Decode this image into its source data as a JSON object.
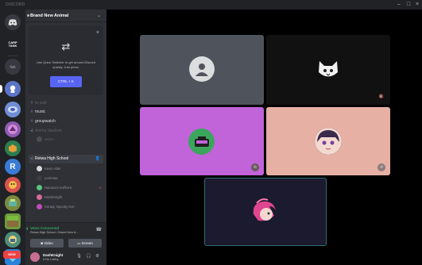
{
  "titlebar": {
    "title": "DISCORD",
    "minimize_icon": "minimize-icon",
    "maximize_icon": "maximize-icon",
    "close_icon": "close-icon"
  },
  "guilds": {
    "items": [
      {
        "name": "home",
        "label": ""
      },
      {
        "name": "carp-tank",
        "label": "CARP TANK"
      },
      {
        "name": "fish",
        "label": "fish"
      },
      {
        "name": "guild-3",
        "label": ""
      },
      {
        "name": "guild-4",
        "label": ""
      },
      {
        "name": "guild-5",
        "label": ""
      },
      {
        "name": "guild-6",
        "label": ""
      },
      {
        "name": "guild-r",
        "label": "R"
      },
      {
        "name": "guild-8",
        "label": ""
      },
      {
        "name": "guild-9",
        "label": ""
      },
      {
        "name": "guild-10",
        "label": ""
      },
      {
        "name": "guild-11",
        "label": ""
      },
      {
        "name": "guild-12",
        "label": ""
      }
    ],
    "new_badge": "NEW"
  },
  "server": {
    "name": "Brand New Animal"
  },
  "quick_switcher": {
    "description": "Use Quick Switcher to get around Discord quickly. Just press:",
    "shortcut": "CTRL + K"
  },
  "channels": [
    {
      "label": "to-wall",
      "kind": "text",
      "state": "dim"
    },
    {
      "label": "music",
      "kind": "text",
      "state": "bright"
    },
    {
      "label": "groupwatch",
      "kind": "text",
      "state": "bright"
    },
    {
      "label": "Anima Stadium",
      "kind": "voice",
      "state": "dim"
    }
  ],
  "stadium_user": "MOXA",
  "active_voice": {
    "label": "Reiwa High School"
  },
  "voice_users": [
    {
      "name": "Kevin Alter",
      "color": "#d4d7dc",
      "status": ""
    },
    {
      "name": "Lemmas",
      "color": "#3a3d43",
      "status": ""
    },
    {
      "name": "Nazuna's KoffeeS·",
      "color": "#59c47e",
      "status": "⨯"
    },
    {
      "name": "DashKnight",
      "color": "#d46b9a",
      "status": ""
    },
    {
      "name": "Kuraqi, Spooky Kat ·",
      "color": "#c04bb8",
      "status": ""
    }
  ],
  "voice_panel": {
    "status": "Voice Connected",
    "subtitle": "Reiwa High School / Brand New A...",
    "video_label": "Video",
    "screen_label": "Screen"
  },
  "user": {
    "name": "DashKnight",
    "tag": "# No Lobby..."
  },
  "video_tiles": [
    {
      "name": "tile-default-avatar",
      "bg": "#4f545c"
    },
    {
      "name": "tile-cat",
      "bg": "#111111"
    },
    {
      "name": "tile-radio",
      "bg": "#c163d9"
    },
    {
      "name": "tile-anime-girl",
      "bg": "#e6b0a4"
    },
    {
      "name": "tile-focused",
      "bg": "#1b1a2e",
      "border": "#2f6d73"
    }
  ]
}
